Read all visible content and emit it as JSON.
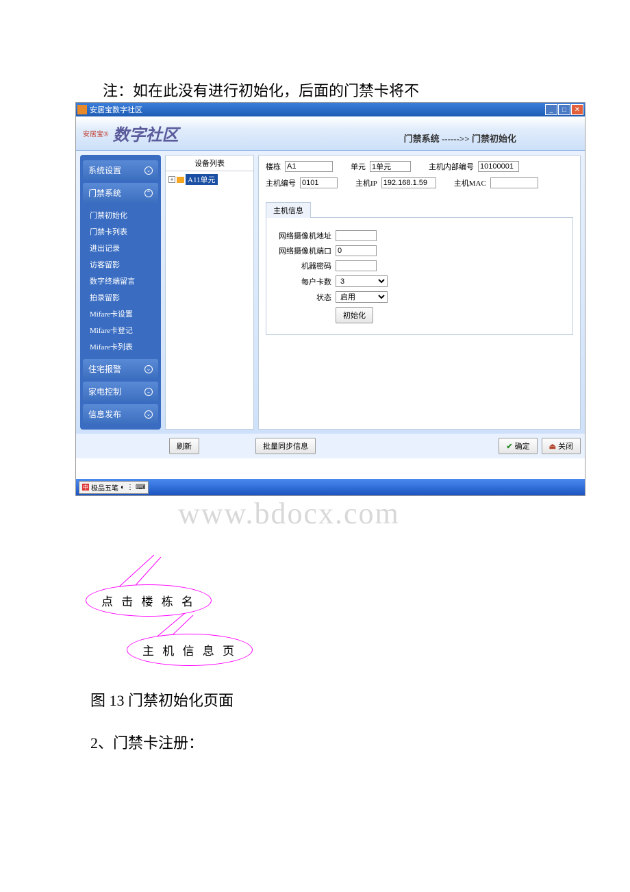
{
  "doc": {
    "note": "注：如在此没有进行初始化，后面的门禁卡将不",
    "fig_caption": "图 13 门禁初始化页面",
    "section2": "2、门禁卡注册：",
    "watermark": "www.bdocx.com"
  },
  "titlebar": {
    "title": "安居宝数字社区"
  },
  "header": {
    "logo_badge": "安居宝®",
    "logo_text": "数字社区",
    "crumb_system": "门禁系统",
    "crumb_sep": " ------>> ",
    "crumb_page": "门禁初始化"
  },
  "sidebar": {
    "groups": [
      {
        "label": "系统设置",
        "open": false
      },
      {
        "label": "门禁系统",
        "open": true
      },
      {
        "label": "住宅报警",
        "open": false
      },
      {
        "label": "家电控制",
        "open": false
      },
      {
        "label": "信息发布",
        "open": false
      }
    ],
    "access_items": [
      "门禁初始化",
      "门禁卡列表",
      "进出记录",
      "访客留影",
      "数字终端留言",
      "拍录留影",
      "Mifare卡设置",
      "Mifare卡登记",
      "Mifare卡列表"
    ]
  },
  "tree": {
    "title": "设备列表",
    "node_label": "A11单元"
  },
  "form": {
    "building_lbl": "楼栋",
    "building_val": "A1",
    "unit_lbl": "单元",
    "unit_val": "1单元",
    "inner_lbl": "主机内部编号",
    "inner_val": "10100001",
    "hostno_lbl": "主机编号",
    "hostno_val": "0101",
    "hostip_lbl": "主机IP",
    "hostip_val": "192.168.1.59",
    "hostmac_lbl": "主机MAC",
    "hostmac_val": "",
    "hostinfo_tab": "主机信息",
    "cam_addr_lbl": "网络摄像机地址",
    "cam_addr_val": "",
    "cam_port_lbl": "网络摄像机端口",
    "cam_port_val": "0",
    "pwd_lbl": "机器密码",
    "pwd_val": "",
    "cards_lbl": "每户卡数",
    "cards_val": "3",
    "status_lbl": "状态",
    "status_val": "启用",
    "init_btn": "初始化"
  },
  "buttons": {
    "refresh": "刷新",
    "batch_sync": "批量同步信息",
    "ok": "确定",
    "close": "关闭"
  },
  "ime": {
    "label": "极品五笔"
  },
  "callouts": {
    "b1": "点 击 楼 栋 名",
    "b2": "主 机 信 息 页"
  }
}
